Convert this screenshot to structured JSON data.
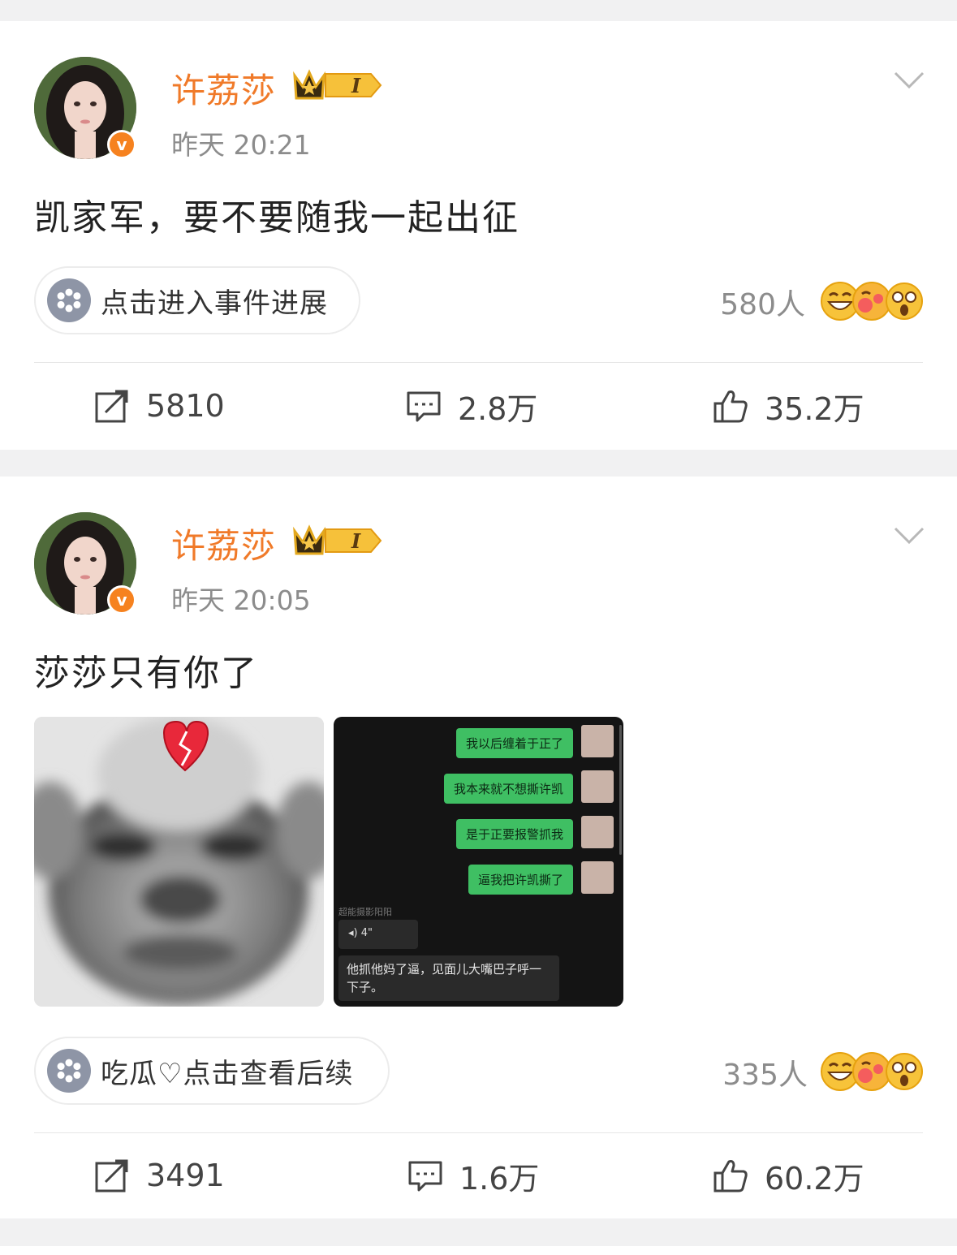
{
  "posts": [
    {
      "username": "许荔莎",
      "level_badge": "I",
      "time": "昨天 20:21",
      "text": "凯家军，要不要随我一起出征",
      "topic_pill": "点击进入事件进展",
      "reaction_count": "580人",
      "actions": {
        "repost": "5810",
        "comment": "2.8万",
        "like": "35.2万"
      }
    },
    {
      "username": "许荔莎",
      "level_badge": "I",
      "time": "昨天 20:05",
      "text": "莎莎只有你了",
      "topic_pill": "吃瓜♡点击查看后续",
      "reaction_count": "335人",
      "actions": {
        "repost": "3491",
        "comment": "1.6万",
        "like": "60.2万"
      },
      "chat_image": {
        "messages": [
          "我以后缠着于正了",
          "我本来就不想撕许凯",
          "是于正要报警抓我",
          "逼我把许凯撕了"
        ],
        "other_name": "超能摄影阳阳",
        "voice_len": "4\"",
        "reply": "他抓他妈了逼，见面儿大嘴巴子呼一下子。"
      }
    }
  ],
  "icons": {
    "verified": "v-badge-icon",
    "crown": "crown-level-icon",
    "more": "chevron-down-icon",
    "topic": "flower-icon",
    "repost": "repost-icon",
    "comment": "comment-icon",
    "like": "thumbs-up-icon"
  },
  "colors": {
    "username": "#f07a29",
    "verified": "#f6821f",
    "chat_bubble": "#3fbf63"
  }
}
